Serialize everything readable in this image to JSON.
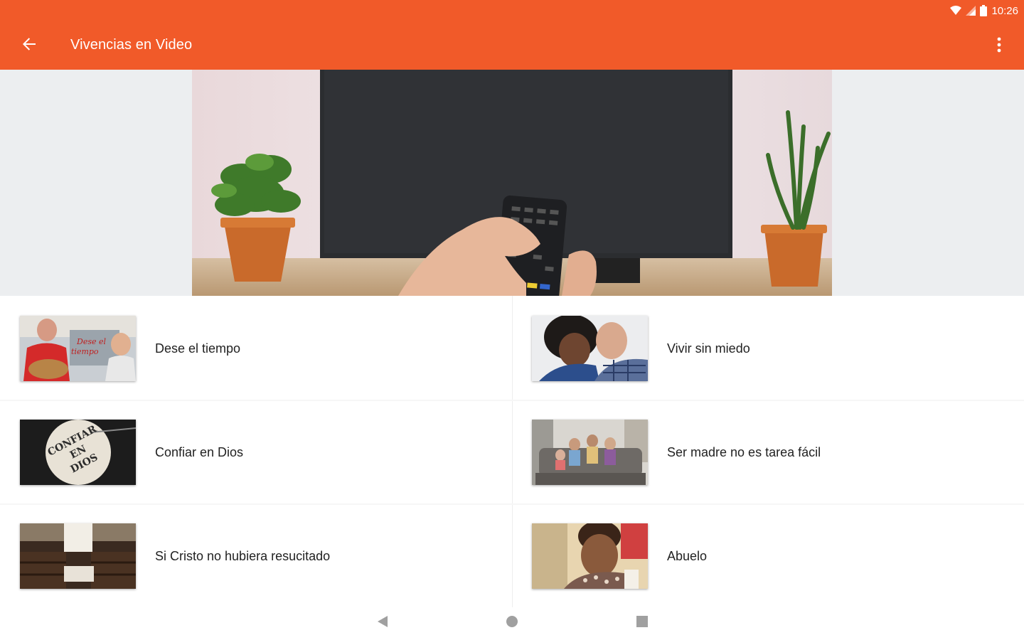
{
  "status_bar": {
    "time": "10:26",
    "icons": [
      "wifi-icon",
      "signal-icon",
      "battery-icon"
    ]
  },
  "app_bar": {
    "title": "Vivencias en Video",
    "back_icon": "arrow-left-icon",
    "menu_icon": "more-vert-icon"
  },
  "hero": {
    "description_icon": "tv-remote-image"
  },
  "videos": [
    {
      "label": "Dese el tiempo"
    },
    {
      "label": "Vivir sin miedo"
    },
    {
      "label": "Confiar en Dios",
      "thumb_text": [
        "CONFIAR",
        "EN",
        "DIOS"
      ]
    },
    {
      "label": "Ser madre no es tarea fácil"
    },
    {
      "label": "Si Cristo no hubiera resucitado"
    },
    {
      "label": "Abuelo"
    }
  ],
  "nav_bar": {
    "icons": [
      "nav-back-icon",
      "nav-home-icon",
      "nav-recents-icon"
    ]
  },
  "colors": {
    "accent": "#F15A29",
    "text": "#222222",
    "background": "#FFFFFF",
    "hero_bg": "#ECEEF0"
  }
}
